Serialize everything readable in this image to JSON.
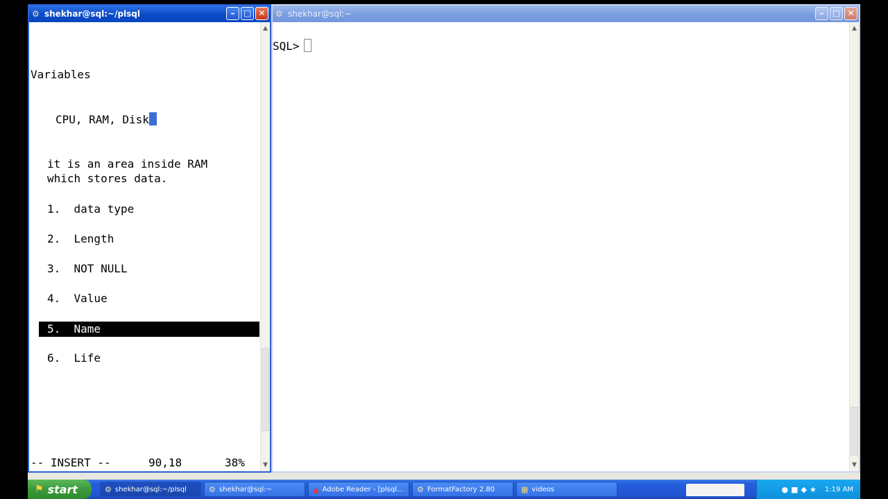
{
  "left_window": {
    "title": "shekhar@sql:~/plsql",
    "lines": {
      "heading": "Variables",
      "components": "CPU, RAM, Disk",
      "def1": "it is an area inside RAM",
      "def2": "which stores data.",
      "item1": "1.  data type",
      "item2": "2.  Length",
      "item3": "3.  NOT NULL",
      "item4": "4.  Value",
      "item5": "5.  Name",
      "item6": "6.  Life"
    },
    "status": {
      "mode": "-- INSERT --",
      "position": "90,18",
      "percent": "38%"
    }
  },
  "right_window": {
    "title": "shekhar@sql:~",
    "prompt": "SQL>"
  },
  "taskbar": {
    "start_label": "start",
    "buttons": [
      {
        "label": "shekhar@sql:~/plsql",
        "icon": "putty-icon"
      },
      {
        "label": "shekhar@sql:~",
        "icon": "putty-icon"
      },
      {
        "label": "Adobe Reader - [plsql...",
        "icon": "adobe-reader-icon"
      },
      {
        "label": "FormatFactory 2.80",
        "icon": "format-factory-icon"
      },
      {
        "label": "videos",
        "icon": "folder-icon"
      }
    ],
    "clock": "1:19 AM"
  },
  "colors": {
    "titlebar_active": "#0a4bc6",
    "titlebar_inactive": "#7a9de0",
    "taskbar": "#245edb",
    "start_button": "#3b9a3b",
    "cursor": "#3b6fd6"
  }
}
